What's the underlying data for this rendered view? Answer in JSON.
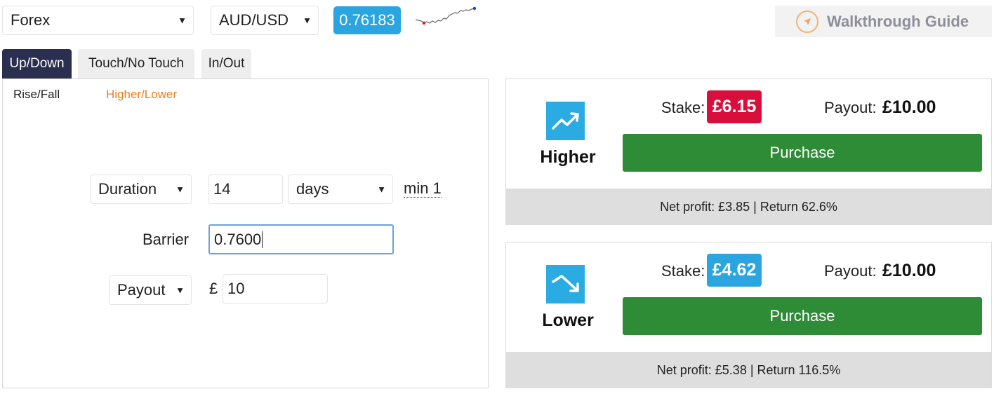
{
  "header": {
    "market": {
      "selected": "Forex"
    },
    "symbol": {
      "selected": "AUD/USD"
    },
    "spot_price": "0.76183",
    "walkthrough_label": "Walkthrough Guide"
  },
  "tabs": [
    {
      "label": "Up/Down",
      "active": true
    },
    {
      "label": "Touch/No Touch",
      "active": false
    },
    {
      "label": "In/Out",
      "active": false
    }
  ],
  "subtabs": [
    {
      "label": "Rise/Fall",
      "active": false
    },
    {
      "label": "Higher/Lower",
      "active": true
    }
  ],
  "form": {
    "duration": {
      "type_selected": "Duration",
      "value": "14",
      "unit_selected": "days",
      "min_note": "min 1"
    },
    "barrier": {
      "label": "Barrier",
      "value": "0.7600"
    },
    "payout": {
      "type_selected": "Payout",
      "currency_symbol": "£",
      "value": "10"
    }
  },
  "contracts": [
    {
      "direction": "Higher",
      "stake_label": "Stake:",
      "stake": "£6.15",
      "stake_color": "#d80f3c",
      "payout_label": "Payout:",
      "payout": "£10.00",
      "purchase_label": "Purchase",
      "summary": "Net profit: £3.85 | Return 62.6%"
    },
    {
      "direction": "Lower",
      "stake_label": "Stake:",
      "stake": "£4.62",
      "stake_color": "#2aa5e0",
      "payout_label": "Payout:",
      "payout": "£10.00",
      "purchase_label": "Purchase",
      "summary": "Net profit: £5.38 | Return 116.5%"
    }
  ],
  "colors": {
    "accent_blue": "#2aa5e0",
    "active_tab": "#2b2f4f",
    "purchase_green": "#2e8b36",
    "subtab_active": "#e98024"
  }
}
